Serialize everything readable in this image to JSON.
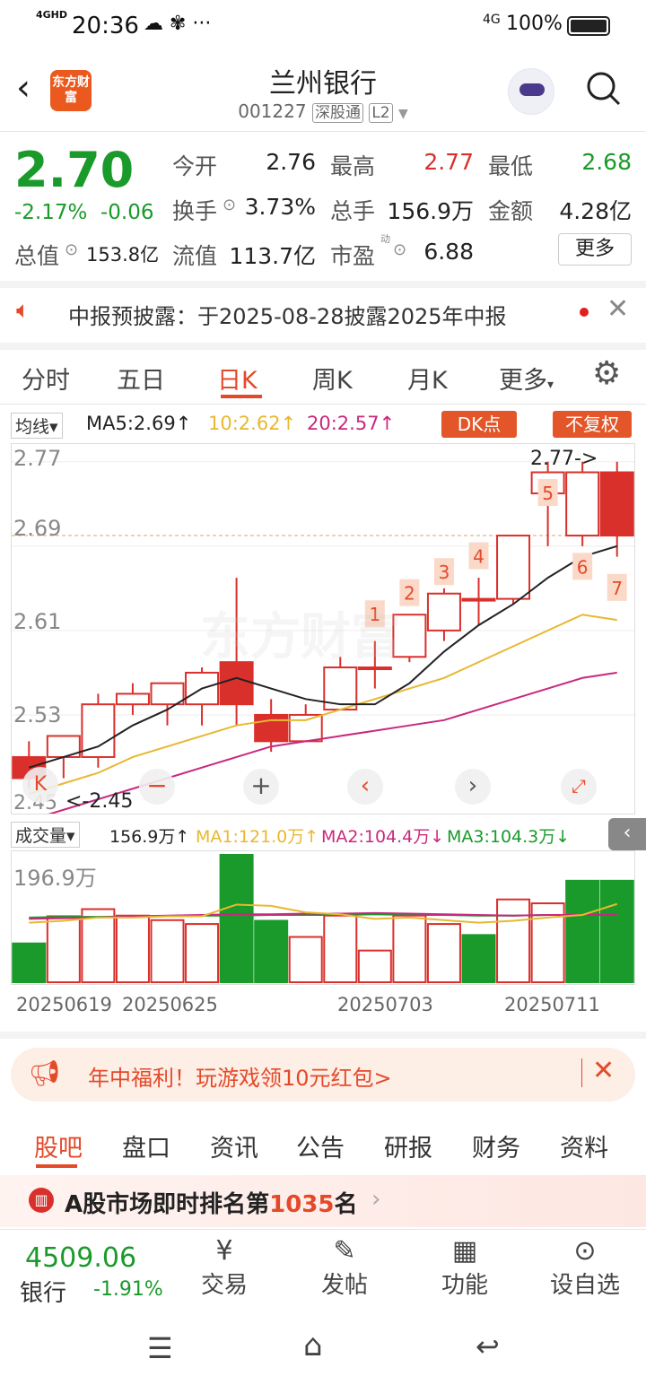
{
  "status": {
    "network": "4GHD",
    "time": "20:36",
    "battery": "100%",
    "signal2": "4G"
  },
  "header": {
    "title": "兰州银行",
    "code": "001227",
    "tag": "深股通",
    "level": "L2",
    "logo_text": "东方财富"
  },
  "quote": {
    "price": "2.70",
    "change_pct": "-2.17%",
    "change": "-0.06",
    "open_label": "今开",
    "open": "2.76",
    "high_label": "最高",
    "high": "2.77",
    "low_label": "最低",
    "low": "2.68",
    "turnover_label": "换手",
    "turnover": "3.73%",
    "volume_label": "总手",
    "volume": "156.9万",
    "amount_label": "金额",
    "amount": "4.28亿",
    "mcap_label": "总值",
    "mcap": "153.8亿",
    "float_label": "流值",
    "float": "113.7亿",
    "pe_label": "市盈",
    "pe_sup": "动",
    "pe": "6.88",
    "more": "更多"
  },
  "notice": {
    "text": "中报预披露：于2025-08-28披露2025年中报"
  },
  "tabs": [
    "分时",
    "五日",
    "日K",
    "周K",
    "月K",
    "更多"
  ],
  "ma": {
    "selector": "均线",
    "ma5": "MA5:2.69",
    "ma10": "10:2.62",
    "ma20": "20:2.57",
    "dk": "DK点",
    "fq": "不复权"
  },
  "chart": {
    "yticks": [
      "2.77",
      "2.69",
      "2.61",
      "2.53",
      "2.45"
    ],
    "high_label": "2.77->",
    "low_label": "<-2.45",
    "watermark": "东方财富",
    "markers": [
      "1",
      "2",
      "3",
      "4",
      "5",
      "6",
      "7"
    ]
  },
  "vol": {
    "selector": "成交量",
    "v": "156.9万",
    "ma1": "MA1:121.0万",
    "ma2": "MA2:104.4万",
    "ma3": "MA3:104.3万",
    "ymax": "196.9万"
  },
  "dates": [
    "20250619",
    "20250625",
    "20250703",
    "20250711"
  ],
  "banner": {
    "text": "年中福利！玩游戏领10元红包>"
  },
  "btabs": [
    "股吧",
    "盘口",
    "资讯",
    "公告",
    "研报",
    "财务",
    "资料"
  ],
  "rank": {
    "prefix": "A股市场即时排名第",
    "num": "1035",
    "suffix": "名"
  },
  "bottom": {
    "index_value": "4509.06",
    "index_name": "银行",
    "index_chg": "-1.91%",
    "trade": "交易",
    "post": "发帖",
    "func": "功能",
    "watch": "设自选"
  },
  "colors": {
    "up": "#d9302c",
    "down": "#1a9a2a",
    "accent": "#e44a2a",
    "ma5": "#222222",
    "ma10": "#e8b830",
    "ma20": "#c8297e"
  },
  "chart_data": {
    "type": "candlestick",
    "candles": [
      {
        "o": 2.49,
        "h": 2.505,
        "l": 2.46,
        "c": 2.47
      },
      {
        "o": 2.49,
        "h": 2.51,
        "l": 2.47,
        "c": 2.51
      },
      {
        "o": 2.49,
        "h": 2.55,
        "l": 2.48,
        "c": 2.54
      },
      {
        "o": 2.54,
        "h": 2.56,
        "l": 2.53,
        "c": 2.55
      },
      {
        "o": 2.54,
        "h": 2.56,
        "l": 2.52,
        "c": 2.56
      },
      {
        "o": 2.54,
        "h": 2.575,
        "l": 2.52,
        "c": 2.57
      },
      {
        "o": 2.58,
        "h": 2.66,
        "l": 2.52,
        "c": 2.54
      },
      {
        "o": 2.53,
        "h": 2.545,
        "l": 2.495,
        "c": 2.505
      },
      {
        "o": 2.505,
        "h": 2.54,
        "l": 2.505,
        "c": 2.53
      },
      {
        "o": 2.535,
        "h": 2.585,
        "l": 2.535,
        "c": 2.575
      },
      {
        "o": 2.575,
        "h": 2.6,
        "l": 2.555,
        "c": 2.575
      },
      {
        "o": 2.585,
        "h": 2.625,
        "l": 2.58,
        "c": 2.625
      },
      {
        "o": 2.61,
        "h": 2.65,
        "l": 2.6,
        "c": 2.645
      },
      {
        "o": 2.64,
        "h": 2.66,
        "l": 2.615,
        "c": 2.64
      },
      {
        "o": 2.64,
        "h": 2.7,
        "l": 2.635,
        "c": 2.7
      },
      {
        "o": 2.74,
        "h": 2.77,
        "l": 2.69,
        "c": 2.76
      },
      {
        "o": 2.7,
        "h": 2.77,
        "l": 2.69,
        "c": 2.76
      },
      {
        "o": 2.76,
        "h": 2.77,
        "l": 2.68,
        "c": 2.7
      }
    ],
    "ma5": [
      2.48,
      2.49,
      2.5,
      2.52,
      2.535,
      2.555,
      2.565,
      2.555,
      2.545,
      2.54,
      2.54,
      2.56,
      2.59,
      2.615,
      2.635,
      2.66,
      2.68,
      2.69
    ],
    "ma10": [
      2.455,
      2.465,
      2.475,
      2.49,
      2.5,
      2.51,
      2.52,
      2.525,
      2.525,
      2.535,
      2.545,
      2.555,
      2.565,
      2.58,
      2.595,
      2.61,
      2.625,
      2.62
    ],
    "ma20": [
      2.43,
      2.44,
      2.45,
      2.46,
      2.47,
      2.48,
      2.49,
      2.5,
      2.505,
      2.51,
      2.515,
      2.52,
      2.525,
      2.535,
      2.545,
      2.555,
      2.565,
      2.57
    ],
    "volume": [
      60,
      102,
      113,
      103,
      96,
      90,
      196.9,
      95,
      70,
      103,
      49,
      103,
      90,
      73,
      128,
      122,
      156.9,
      156.9
    ],
    "vol_up": [
      false,
      true,
      true,
      true,
      true,
      true,
      false,
      false,
      true,
      true,
      true,
      true,
      true,
      false,
      true,
      true,
      false,
      false
    ],
    "yrange": [
      2.45,
      2.78
    ]
  }
}
